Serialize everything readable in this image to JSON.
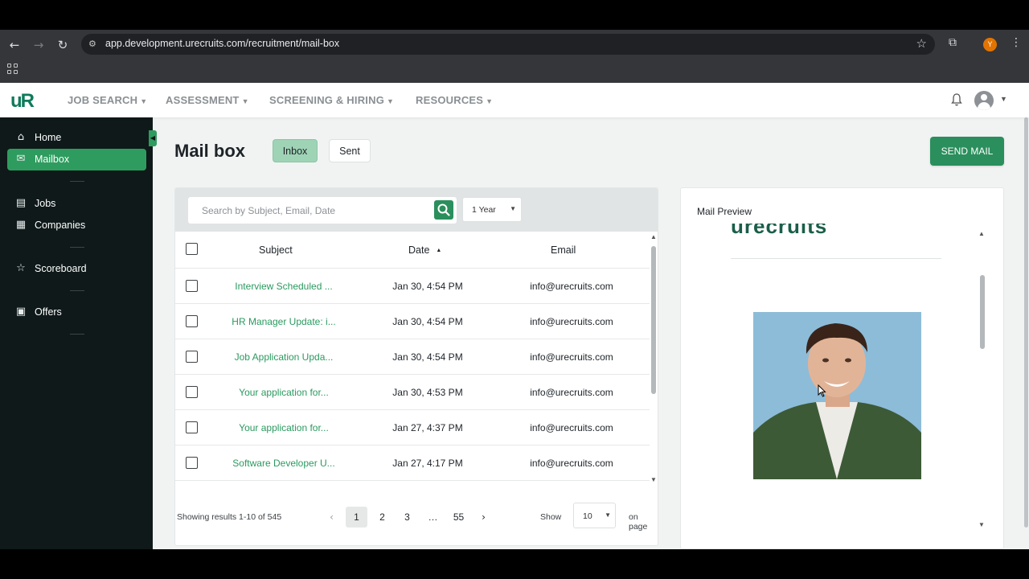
{
  "browser": {
    "url": "app.development.urecruits.com/recruitment/mail-box",
    "profile_initial": "Y"
  },
  "header": {
    "logo": "uR",
    "nav": [
      {
        "label": "JOB SEARCH"
      },
      {
        "label": "ASSESSMENT"
      },
      {
        "label": "SCREENING & HIRING"
      },
      {
        "label": "RESOURCES"
      }
    ]
  },
  "sidebar": {
    "items": [
      {
        "label": "Home",
        "icon": "home-icon"
      },
      {
        "label": "Mailbox",
        "icon": "mail-icon",
        "active": true
      },
      {
        "label": "Jobs",
        "icon": "briefcase-icon"
      },
      {
        "label": "Companies",
        "icon": "building-icon"
      },
      {
        "label": "Scoreboard",
        "icon": "star-icon"
      },
      {
        "label": "Offers",
        "icon": "offer-icon"
      }
    ]
  },
  "main": {
    "title": "Mail box",
    "tabs": [
      {
        "label": "Inbox",
        "active": true
      },
      {
        "label": "Sent",
        "active": false
      }
    ],
    "send_mail_label": "SEND MAIL"
  },
  "mail_list": {
    "search_placeholder": "Search by Subject, Email, Date",
    "period": "1 Year",
    "columns": {
      "subject": "Subject",
      "date": "Date",
      "email": "Email"
    },
    "rows": [
      {
        "subject": "Interview Scheduled ...",
        "date": "Jan 30, 4:54 PM",
        "email": "info@urecruits.com"
      },
      {
        "subject": "HR Manager Update: i...",
        "date": "Jan 30, 4:54 PM",
        "email": "info@urecruits.com"
      },
      {
        "subject": "Job Application Upda...",
        "date": "Jan 30, 4:54 PM",
        "email": "info@urecruits.com"
      },
      {
        "subject": "Your application for...",
        "date": "Jan 30, 4:53 PM",
        "email": "info@urecruits.com"
      },
      {
        "subject": "Your application for...",
        "date": "Jan 27, 4:37 PM",
        "email": "info@urecruits.com"
      },
      {
        "subject": "Software Developer U...",
        "date": "Jan 27, 4:17 PM",
        "email": "info@urecruits.com"
      }
    ],
    "showing_text": "Showing results 1-10 of 545",
    "pages": [
      "1",
      "2",
      "3",
      "…",
      "55"
    ],
    "current_page": "1",
    "show_label": "Show",
    "page_size": "10",
    "on_page_label": "on page"
  },
  "preview": {
    "title": "Mail Preview",
    "logo_text": "urecruits"
  },
  "colors": {
    "accent": "#2a8f5c",
    "link": "#2a9a5f",
    "sidebar_bg": "#0f1919"
  }
}
